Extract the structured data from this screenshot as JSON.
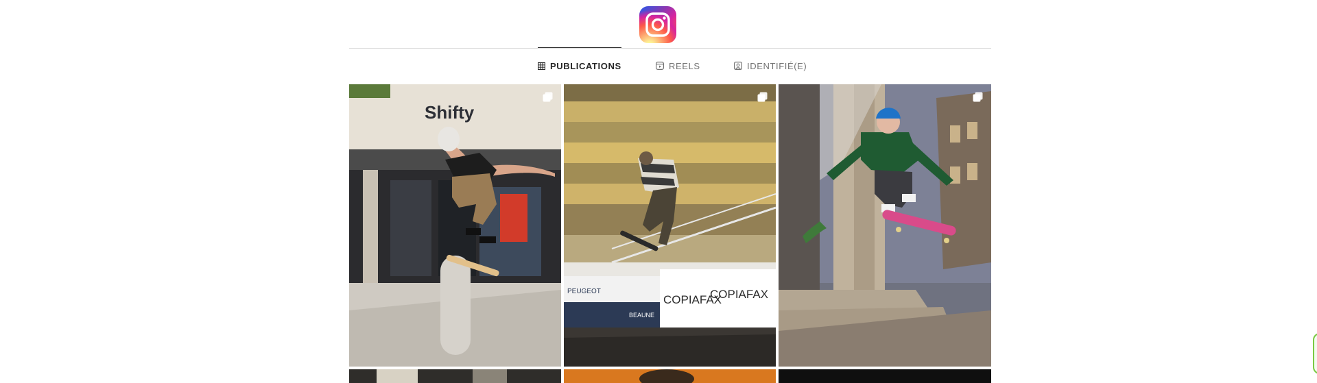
{
  "header": {
    "logo_icon": "instagram-logo-icon"
  },
  "tabs": [
    {
      "label": "PUBLICATIONS",
      "icon": "grid-icon",
      "active": true
    },
    {
      "label": "REELS",
      "icon": "reels-icon",
      "active": false
    },
    {
      "label": "IDENTIFIÉ(E)",
      "icon": "tagged-icon",
      "active": false
    }
  ],
  "posts": [
    {
      "subject": "skater-kickflip-shop-front",
      "multiple": true
    },
    {
      "subject": "skater-stairs-rail",
      "multiple": true
    },
    {
      "subject": "skater-column-night",
      "multiple": true
    },
    {
      "subject": "partial-dark",
      "multiple": false
    },
    {
      "subject": "partial-orange",
      "multiple": false
    },
    {
      "subject": "partial-black",
      "multiple": false
    }
  ],
  "photo_text": {
    "shop_sign": "Shifty",
    "banner_1": "COPIAFAX",
    "banner_2": "COPIAFAX",
    "banner_3": "PEUGEOT",
    "banner_4": "BEAUNE"
  },
  "colors": {
    "accent_green": "#7ac943",
    "text_primary": "#262626",
    "text_secondary": "#737373"
  }
}
